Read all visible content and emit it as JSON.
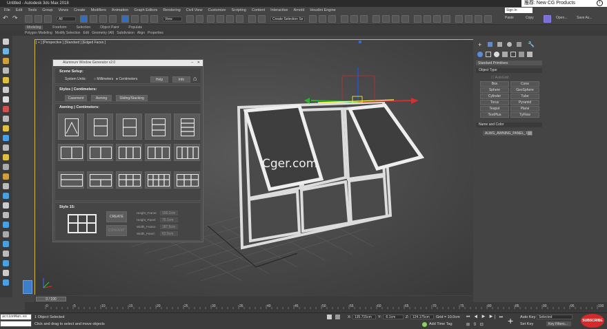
{
  "window": {
    "title": "Untitled - Autodesk 3ds Max 2018",
    "sign_in": "Sign In",
    "promo": "推荐:  New CG Products",
    "info_icon": "info-icon"
  },
  "menu": [
    "File",
    "Edit",
    "Tools",
    "Group",
    "Views",
    "Create",
    "Modifiers",
    "Animation",
    "Graph Editors",
    "Rendering",
    "Civil View",
    "Customize",
    "Scripting",
    "Content",
    "Interactive",
    "Arnold",
    "Houdini Engine"
  ],
  "toolbar": {
    "filter": "All",
    "ref_coord": "View",
    "selection_set": "Create Selection Se",
    "paste": "Paste",
    "copy": "Copy",
    "open": "Open...",
    "save_as": "Save As..."
  },
  "ribbon": {
    "tabs": [
      "Modeling",
      "Freeform",
      "Selection",
      "Object Paint",
      "Populate"
    ],
    "sub": [
      "Polygon Modeling",
      "Modify Selection",
      "Edit",
      "Geometry (All)",
      "Subdivision",
      "Align",
      "Properties"
    ]
  },
  "viewport": {
    "label": "[ + ] [Perspective ] [Standard ] [Edged Faces ]"
  },
  "watermark": "Cger.com",
  "dialog": {
    "title": "Aluminum Window Generator v2.0",
    "scene_setup": "Scene Setup:",
    "system_units": "System Units:",
    "millimeters": "Millimeters",
    "centimeters": "Centimeters",
    "help": "Help",
    "info": "Info",
    "styles_title": "Styles | Centimeters:",
    "style_buttons": [
      "Casement",
      "Awning",
      "Sliding/Stacking"
    ],
    "awning_title": "Awning | Centimeters:",
    "style_title": "Style 15:",
    "create": "CREATE",
    "convert": "CONVERT",
    "params": [
      {
        "label": "Height_Frame:",
        "value": "156.2cm"
      },
      {
        "label": "Height_Panel:",
        "value": "75.1cm"
      },
      {
        "label": "Width_Frame:",
        "value": "187.5cm"
      },
      {
        "label": "Width_Panel:",
        "value": "62.5cm"
      }
    ]
  },
  "command_panel": {
    "dropdown": "Standard Primitives",
    "object_type": "Object Type",
    "autogrid": "AutoGrid",
    "primitives": [
      "Box",
      "Cone",
      "Sphere",
      "GeoSphere",
      "Cylinder",
      "Tube",
      "Torus",
      "Pyramid",
      "Teapot",
      "Plane",
      "TextPlus",
      "TyFlow"
    ],
    "name_color": "Name and Color",
    "object_name": "ALWG_AWNING_PANEL_1"
  },
  "timeline": {
    "frame": "0 / 100",
    "ticks": [
      "0",
      "5",
      "10",
      "15",
      "20",
      "25",
      "30",
      "35",
      "40",
      "45",
      "50",
      "55",
      "60",
      "65",
      "70",
      "75",
      "80",
      "85",
      "90",
      "95",
      "100"
    ]
  },
  "status": {
    "script_listener": "actionMan.ex",
    "selected": "1 Object Selected",
    "prompt": "Click and drag to select and move objects",
    "x_label": "X:",
    "x": "135.715cm",
    "y_label": "Y:",
    "y": "-6.1cm",
    "z_label": "Z:",
    "z": "124.175cm",
    "grid": "Grid = 10.0cm",
    "add_time_tag": "Add Time Tag",
    "auto_key": "Auto Key",
    "selected_dd": "Selected",
    "set_key": "Set Key",
    "key_filters": "Key Filters...",
    "subscribe": "SUBSCRIBE"
  }
}
